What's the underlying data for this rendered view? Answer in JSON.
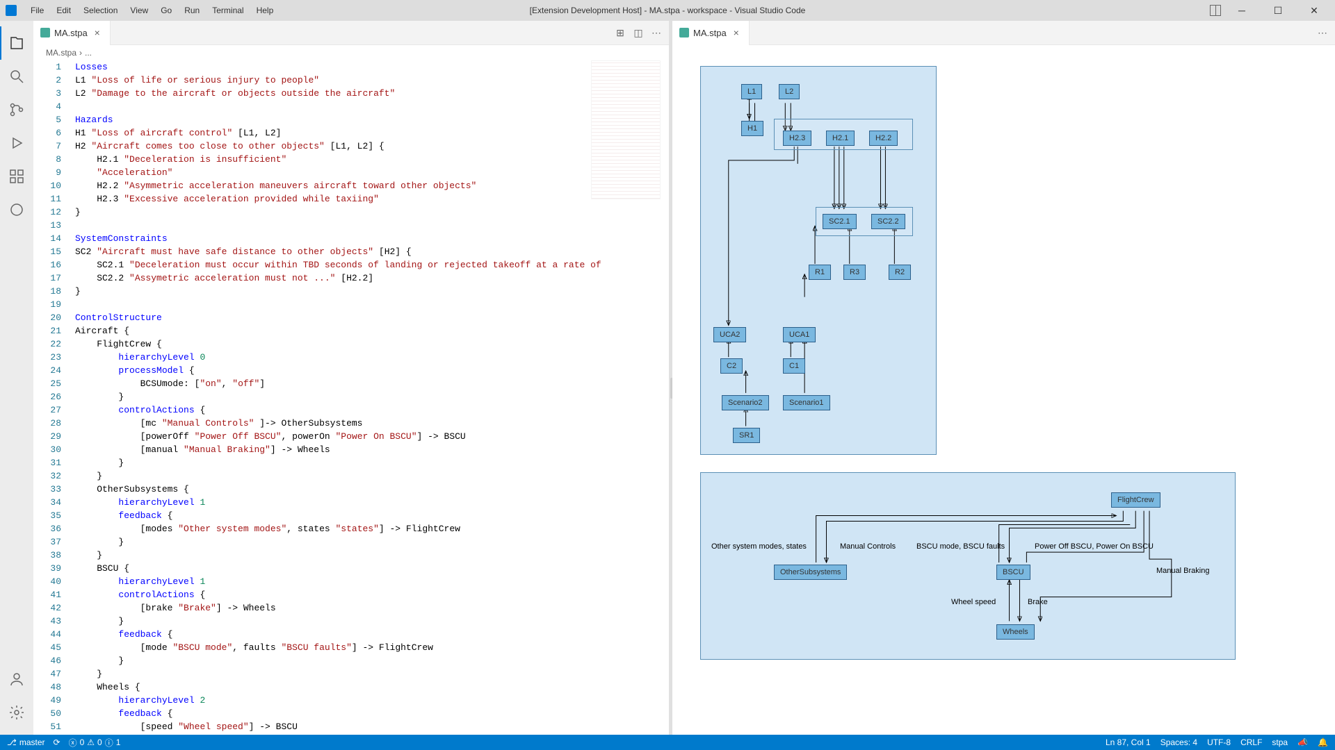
{
  "window": {
    "title": "[Extension Development Host] - MA.stpa - workspace - Visual Studio Code"
  },
  "menu": [
    "File",
    "Edit",
    "Selection",
    "View",
    "Go",
    "Run",
    "Terminal",
    "Help"
  ],
  "tabs": {
    "left": "MA.stpa",
    "right": "MA.stpa"
  },
  "breadcrumb": {
    "file": "MA.stpa",
    "sep": "›",
    "more": "..."
  },
  "code": [
    {
      "n": 1,
      "raw": "<span class='tok-kw'>Losses</span>"
    },
    {
      "n": 2,
      "raw": "L1 <span class='tok-str'>\"Loss of life or serious injury to people\"</span>"
    },
    {
      "n": 3,
      "raw": "L2 <span class='tok-str'>\"Damage to the aircraft or objects outside the aircraft\"</span>"
    },
    {
      "n": 4,
      "raw": ""
    },
    {
      "n": 5,
      "raw": "<span class='tok-kw'>Hazards</span>"
    },
    {
      "n": 6,
      "raw": "H1 <span class='tok-str'>\"Loss of aircraft control\"</span> [L1, L2]"
    },
    {
      "n": 7,
      "raw": "H2 <span class='tok-str'>\"Aircraft comes too close to other objects\"</span> [L1, L2] {"
    },
    {
      "n": 8,
      "raw": "    H2.1 <span class='tok-str'>\"Deceleration is insufficient\"</span>"
    },
    {
      "n": 9,
      "raw": "    <span class='tok-str'>\"Acceleration\"</span>"
    },
    {
      "n": 10,
      "raw": "    H2.2 <span class='tok-str'>\"Asymmetric acceleration maneuvers aircraft toward other objects\"</span>"
    },
    {
      "n": 11,
      "raw": "    H2.3 <span class='tok-str'>\"Excessive acceleration provided while taxiing\"</span>"
    },
    {
      "n": 12,
      "raw": "}"
    },
    {
      "n": 13,
      "raw": ""
    },
    {
      "n": 14,
      "raw": "<span class='tok-kw'>SystemConstraints</span>"
    },
    {
      "n": 15,
      "raw": "SC2 <span class='tok-str'>\"Aircraft must have safe distance to other objects\"</span> [H2] {"
    },
    {
      "n": 16,
      "raw": "    SC2.1 <span class='tok-str'>\"Deceleration must occur within TBD seconds of landing or rejected takeoff at a rate of </span>"
    },
    {
      "n": 17,
      "raw": "    SC2.2 <span class='tok-str'>\"Assymetric acceleration must not ...\"</span> [H2.2]"
    },
    {
      "n": 18,
      "raw": "}"
    },
    {
      "n": 19,
      "raw": ""
    },
    {
      "n": 20,
      "raw": "<span class='tok-kw'>ControlStructure</span>"
    },
    {
      "n": 21,
      "raw": "Aircraft {"
    },
    {
      "n": 22,
      "raw": "    FlightCrew {"
    },
    {
      "n": 23,
      "raw": "        <span class='tok-kw'>hierarchyLevel</span> <span class='tok-num'>0</span>"
    },
    {
      "n": 24,
      "raw": "        <span class='tok-kw'>processModel</span> {"
    },
    {
      "n": 25,
      "raw": "            BCSUmode: [<span class='tok-str'>\"on\"</span>, <span class='tok-str'>\"off\"</span>]"
    },
    {
      "n": 26,
      "raw": "        }"
    },
    {
      "n": 27,
      "raw": "        <span class='tok-kw'>controlActions</span> {"
    },
    {
      "n": 28,
      "raw": "            [mc <span class='tok-str'>\"Manual Controls\"</span> ]-> OtherSubsystems"
    },
    {
      "n": 29,
      "raw": "            [powerOff <span class='tok-str'>\"Power Off BSCU\"</span>, powerOn <span class='tok-str'>\"Power On BSCU\"</span>] -> BSCU"
    },
    {
      "n": 30,
      "raw": "            [manual <span class='tok-str'>\"Manual Braking\"</span>] -> Wheels"
    },
    {
      "n": 31,
      "raw": "        }"
    },
    {
      "n": 32,
      "raw": "    }"
    },
    {
      "n": 33,
      "raw": "    OtherSubsystems {"
    },
    {
      "n": 34,
      "raw": "        <span class='tok-kw'>hierarchyLevel</span> <span class='tok-num'>1</span>"
    },
    {
      "n": 35,
      "raw": "        <span class='tok-kw'>feedback</span> {"
    },
    {
      "n": 36,
      "raw": "            [modes <span class='tok-str'>\"Other system modes\"</span>, states <span class='tok-str'>\"states\"</span>] -> FlightCrew"
    },
    {
      "n": 37,
      "raw": "        }"
    },
    {
      "n": 38,
      "raw": "    }"
    },
    {
      "n": 39,
      "raw": "    BSCU {"
    },
    {
      "n": 40,
      "raw": "        <span class='tok-kw'>hierarchyLevel</span> <span class='tok-num'>1</span>"
    },
    {
      "n": 41,
      "raw": "        <span class='tok-kw'>controlActions</span> {"
    },
    {
      "n": 42,
      "raw": "            [brake <span class='tok-str'>\"Brake\"</span>] -> Wheels"
    },
    {
      "n": 43,
      "raw": "        }"
    },
    {
      "n": 44,
      "raw": "        <span class='tok-kw'>feedback</span> {"
    },
    {
      "n": 45,
      "raw": "            [mode <span class='tok-str'>\"BSCU mode\"</span>, faults <span class='tok-str'>\"BSCU faults\"</span>] -> FlightCrew"
    },
    {
      "n": 46,
      "raw": "        }"
    },
    {
      "n": 47,
      "raw": "    }"
    },
    {
      "n": 48,
      "raw": "    Wheels {"
    },
    {
      "n": 49,
      "raw": "        <span class='tok-kw'>hierarchyLevel</span> <span class='tok-num'>2</span>"
    },
    {
      "n": 50,
      "raw": "        <span class='tok-kw'>feedback</span> {"
    },
    {
      "n": 51,
      "raw": "            [speed <span class='tok-str'>\"Wheel speed\"</span>] -> BSCU"
    }
  ],
  "diagram1": {
    "nodes": {
      "L1": "L1",
      "L2": "L2",
      "H1": "H1",
      "H23": "H2.3",
      "H21": "H2.1",
      "H22": "H2.2",
      "SC21": "SC2.1",
      "SC22": "SC2.2",
      "R1": "R1",
      "R3": "R3",
      "R2": "R2",
      "UCA2": "UCA2",
      "UCA1": "UCA1",
      "C2": "C2",
      "C1": "C1",
      "Scenario2": "Scenario2",
      "Scenario1": "Scenario1",
      "SR1": "SR1"
    }
  },
  "diagram2": {
    "nodes": {
      "FlightCrew": "FlightCrew",
      "OtherSubsystems": "OtherSubsystems",
      "BSCU": "BSCU",
      "Wheels": "Wheels"
    },
    "labels": {
      "osm": "Other system modes, states",
      "mc": "Manual Controls",
      "bm": "BSCU mode, BSCU faults",
      "po": "Power Off BSCU, Power On BSCU",
      "mb": "Manual Braking",
      "ws": "Wheel speed",
      "br": "Brake"
    }
  },
  "status": {
    "branch": "master",
    "sync": "",
    "errors": "0",
    "warnings": "0",
    "info": "1",
    "cursor": "Ln 87, Col 1",
    "spaces": "Spaces: 4",
    "encoding": "UTF-8",
    "eol": "CRLF",
    "lang": "stpa"
  }
}
